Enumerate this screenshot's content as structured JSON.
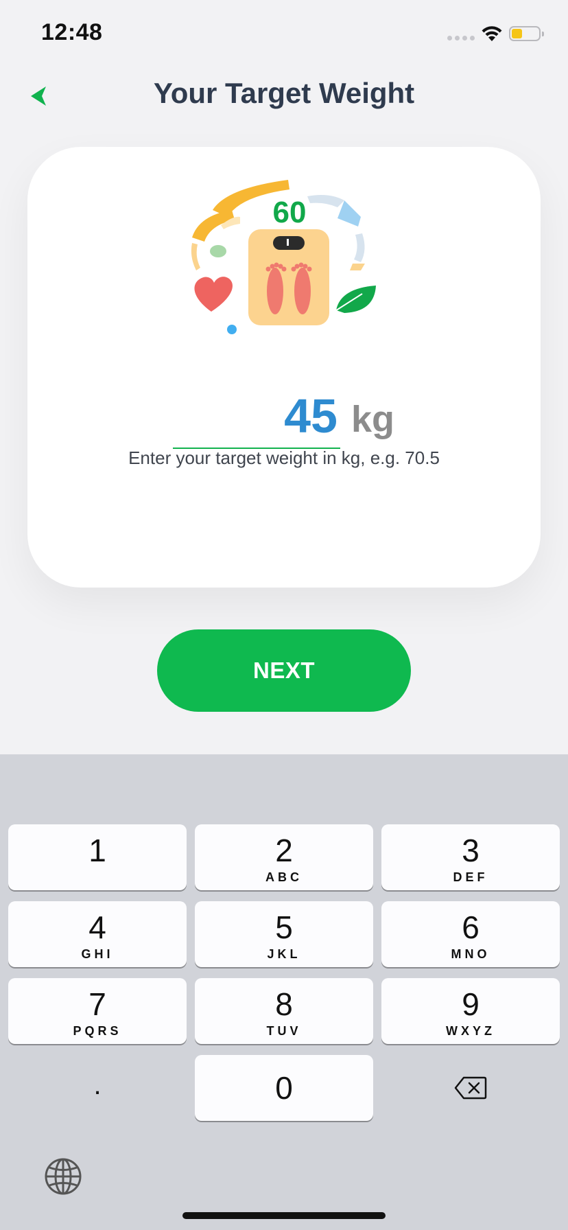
{
  "status_bar": {
    "time": "12:48",
    "battery_level": 0.3
  },
  "header": {
    "title": "Your Target Weight",
    "back_icon": "chevron-left-icon"
  },
  "card": {
    "illustration_scale_number": "60",
    "weight_value": "45",
    "unit": "kg",
    "hint": "Enter your target weight in kg, e.g. 70.5"
  },
  "next_label": "NEXT",
  "colors": {
    "accent": "#0fb94f",
    "value": "#2e8bd0",
    "title": "#2f3b4e"
  },
  "keyboard": {
    "keys": [
      {
        "num": "1",
        "letters": ""
      },
      {
        "num": "2",
        "letters": "ABC"
      },
      {
        "num": "3",
        "letters": "DEF"
      },
      {
        "num": "4",
        "letters": "GHI"
      },
      {
        "num": "5",
        "letters": "JKL"
      },
      {
        "num": "6",
        "letters": "MNO"
      },
      {
        "num": "7",
        "letters": "PQRS"
      },
      {
        "num": "8",
        "letters": "TUV"
      },
      {
        "num": "9",
        "letters": "WXYZ"
      },
      {
        "num": "0",
        "letters": ""
      }
    ],
    "decimal": ".",
    "delete_icon": "backspace-icon",
    "globe_icon": "globe-icon"
  }
}
